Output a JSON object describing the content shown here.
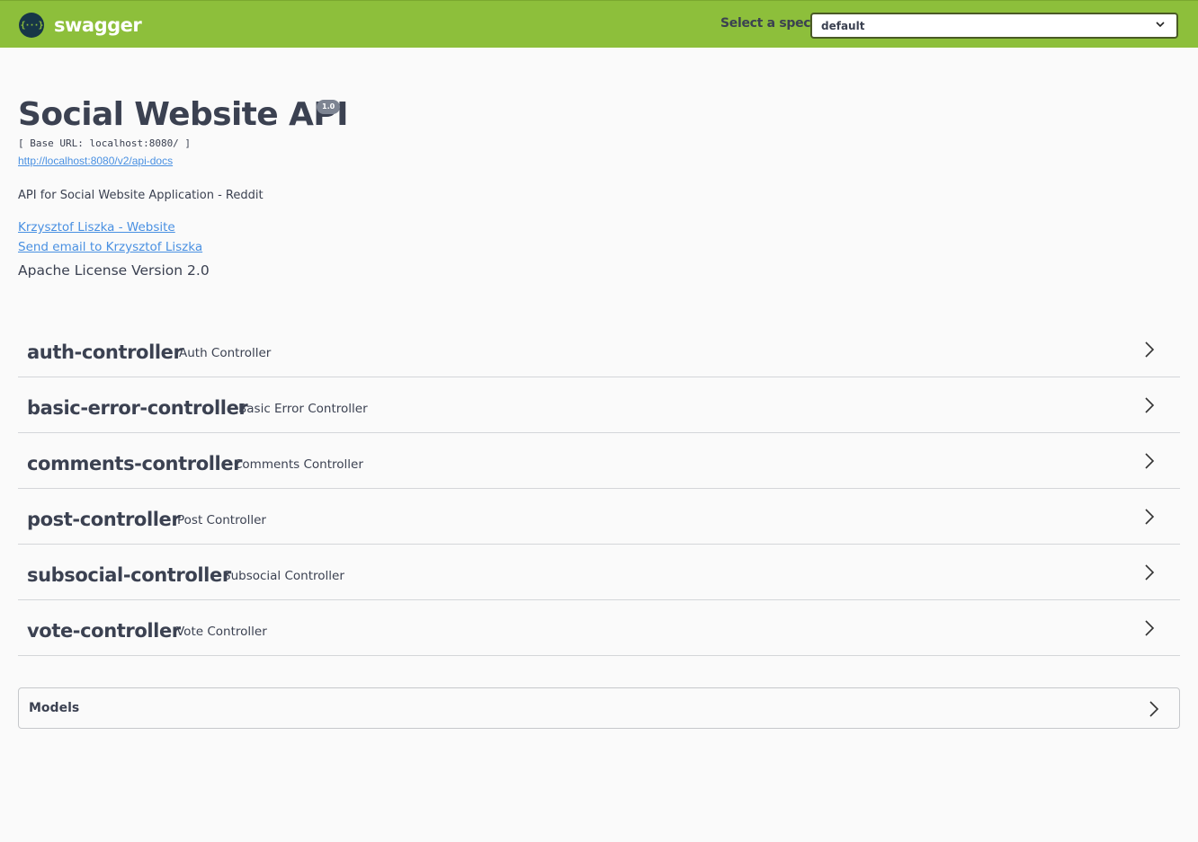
{
  "topbar": {
    "brand": "swagger",
    "logo_glyph": "{···}",
    "spec_label": "Select a spec",
    "spec_selected": "default",
    "bg_color": "#8dbf3b"
  },
  "info": {
    "title": "Social Website API",
    "version": "1.0",
    "base_url": "[ Base URL: localhost:8080/ ]",
    "api_docs_url": "http://localhost:8080/v2/api-docs",
    "description": "API for Social Website Application - Reddit",
    "website_link": "Krzysztof Liszka - Website",
    "email_link": "Send email to Krzysztof Liszka",
    "license": "Apache License Version 2.0"
  },
  "tags": [
    {
      "name": "auth-controller",
      "description": "Auth Controller"
    },
    {
      "name": "basic-error-controller",
      "description": "Basic Error Controller"
    },
    {
      "name": "comments-controller",
      "description": "Comments Controller"
    },
    {
      "name": "post-controller",
      "description": "Post Controller"
    },
    {
      "name": "subsocial-controller",
      "description": "Subsocial Controller"
    },
    {
      "name": "vote-controller",
      "description": "Vote Controller"
    }
  ],
  "models": {
    "label": "Models"
  },
  "icons": {
    "logo": "swagger-logo-icon",
    "dropdown": "chevron-down-icon",
    "expand": "chevron-right-icon"
  }
}
